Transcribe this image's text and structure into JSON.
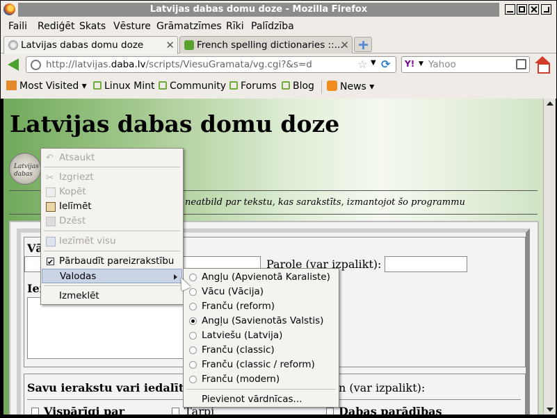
{
  "window": {
    "title": "Latvijas dabas domu doze - Mozilla Firefox"
  },
  "menubar": [
    "Faili",
    "Rediģēt",
    "Skats",
    "Vēsture",
    "Grāmatzīmes",
    "Rīki",
    "Palīdzība"
  ],
  "tabs": [
    {
      "label": "Latvijas dabas domu doze",
      "active": true
    },
    {
      "label": "French spelling dictionaries ::...",
      "active": false
    }
  ],
  "navbar": {
    "url_prefix": "http://latvijas.",
    "url_domain": "daba.lv",
    "url_suffix": "/scripts/ViesuGramata/vg.cgi?&s=d",
    "search_placeholder": "Yahoo",
    "search_engine": "Y!"
  },
  "bookmarks": [
    "Most Visited",
    "Linux Mint",
    "Community",
    "Forums",
    "Blog",
    "News"
  ],
  "page": {
    "title": "Latvijas dabas domu doze",
    "logo_text": "Latvijas dabas",
    "disclaimer": "neatbild par tekstu, kas sarakstīts, izmantojot šo programmu",
    "label_name": "Vā",
    "label_password": "Parole (var izpalikt):",
    "label_entry": "Ier",
    "section_share": "Savu ierakstu vari iedalīt",
    "section_share_tail": "n (var izpalikt):",
    "categories": [
      "Vispārīgi par",
      "Tārpi",
      "Dabas parādības"
    ]
  },
  "context_menu": {
    "items": [
      {
        "label": "Atsaukt",
        "enabled": false
      },
      {
        "label": "Izgriezt",
        "enabled": false
      },
      {
        "label": "Kopēt",
        "enabled": false
      },
      {
        "label": "Ielīmēt",
        "enabled": true
      },
      {
        "label": "Dzēst",
        "enabled": false
      },
      {
        "label": "Iezīmēt visu",
        "enabled": false
      },
      {
        "label": "Pārbaudīt pareizrakstību",
        "enabled": true,
        "checked": true
      },
      {
        "label": "Valodas",
        "enabled": true,
        "submenu": true
      },
      {
        "label": "Izmeklēt",
        "enabled": true
      }
    ]
  },
  "languages_submenu": {
    "items": [
      {
        "label": "Angļu (Apvienotā Karaliste)",
        "selected": false
      },
      {
        "label": "Vācu (Vācija)",
        "selected": false
      },
      {
        "label": "Franču (reform)",
        "selected": false
      },
      {
        "label": "Angļu (Savienotās Valstis)",
        "selected": true
      },
      {
        "label": "Latviešu (Latvija)",
        "selected": false
      },
      {
        "label": "Franču (classic)",
        "selected": false
      },
      {
        "label": "Franču (classic / reform)",
        "selected": false
      },
      {
        "label": "Franču (modern)",
        "selected": false
      }
    ],
    "add_dictionaries": "Pievienot vārdnīcas..."
  }
}
